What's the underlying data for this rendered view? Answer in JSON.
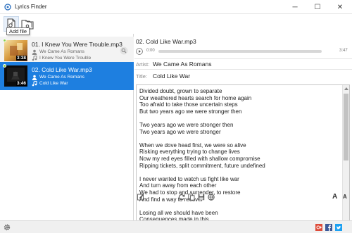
{
  "window": {
    "title": "Lyrics Finder",
    "minimize_glyph": "─",
    "maximize_glyph": "☐",
    "close_glyph": "✕"
  },
  "toolbar": {
    "tooltip": "Add file",
    "buttons": [
      {
        "icon": "add-file-icon"
      },
      {
        "icon": "add-folder-icon"
      }
    ]
  },
  "colors": {
    "selection": "#1e7fe0",
    "accent": "#0a66c2",
    "seekbar": "#d7d7d7"
  },
  "tracks": [
    {
      "title": "01. I Knew You Were Trouble.mp3",
      "artist": "We Came As Romans",
      "song": "I Knew You Were Trouble",
      "duration": "3:38",
      "selected": false
    },
    {
      "title": "02. Cold Like War.mp3",
      "artist": "We Came As Romans",
      "song": "Cold Like War",
      "duration": "3:46",
      "selected": true
    }
  ],
  "detail": {
    "file_name": "02. Cold Like War.mp3",
    "time_start": "0:00",
    "time_end": "3:47",
    "artist_label": "Artist:",
    "artist_value": "We Came As Romans",
    "title_label": "Title:",
    "title_value": "Cold Like War"
  },
  "lyrics": [
    "Divided doubt, grown to separate",
    "Our weathered hearts search for home again",
    "Too afraid to take those uncertain steps",
    "But two years ago we were stronger then",
    "",
    "Two years ago we were stronger then",
    "Two years ago we were stronger",
    "",
    "When we dove head first, we were so alive",
    "Risking everything trying to change lives",
    "Now my red eyes filled with shallow compromise",
    "Ripping tickets, split commitment, future undefined",
    "",
    "I never wanted to watch us fight like war",
    "And turn away from each other",
    "We had to stop and surrender, to restore",
    "And find a way to recover",
    "",
    "Losing all we should have been",
    "Consequences made in this"
  ],
  "lyrics_toolbar": {
    "icons": [
      "edit-icon",
      "refresh-icon",
      "copy-icon",
      "save-icon",
      "web-icon"
    ],
    "font_increase": "A",
    "font_decrease": "A"
  },
  "status_bar": {
    "icons": [
      "settings-icon",
      "google-plus-icon",
      "facebook-icon",
      "twitter-icon"
    ]
  }
}
